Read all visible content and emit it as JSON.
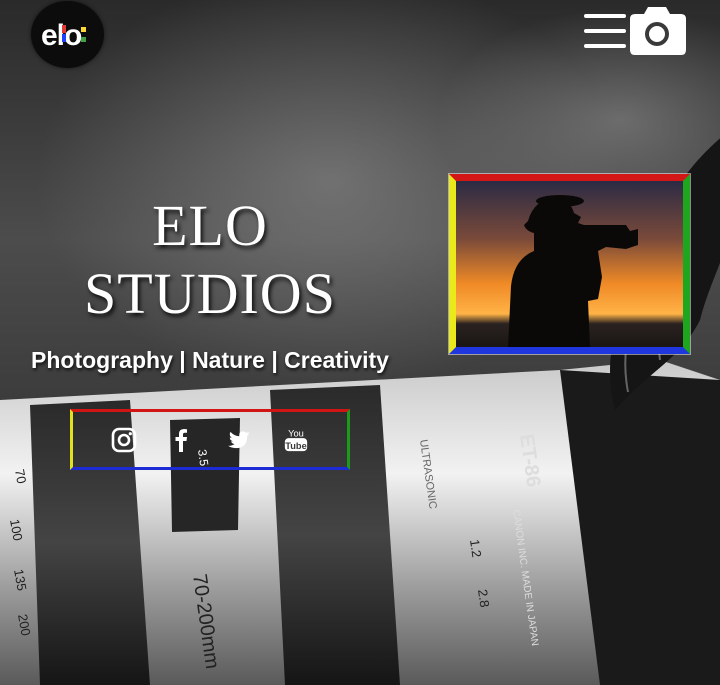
{
  "header": {
    "logo_text": "elo",
    "menu_icon": "hamburger-camera-icon"
  },
  "hero": {
    "title_line1": "ELO",
    "title_line2": "STUDIOS",
    "tagline": "Photography | Nature | Creativity"
  },
  "social": [
    {
      "name": "instagram",
      "icon": "instagram-icon"
    },
    {
      "name": "facebook",
      "icon": "facebook-icon"
    },
    {
      "name": "twitter",
      "icon": "twitter-icon"
    },
    {
      "name": "youtube",
      "icon": "youtube-icon",
      "icon_text_top": "You",
      "icon_text_bottom": "Tube"
    }
  ],
  "background": {
    "lens_markings": [
      "70-200mm",
      "ET-86",
      "CANON INC. MADE IN JAPAN",
      "ULTRASONIC",
      "1.2",
      "2.8",
      "3.5",
      "70",
      "100",
      "135",
      "200"
    ]
  },
  "colors": {
    "frame_top": "#d31616",
    "frame_bottom": "#2037e0",
    "frame_left": "#eaea1a",
    "frame_right": "#1ea71e",
    "text": "#ffffff",
    "logo_bg": "#0c0c0c"
  }
}
